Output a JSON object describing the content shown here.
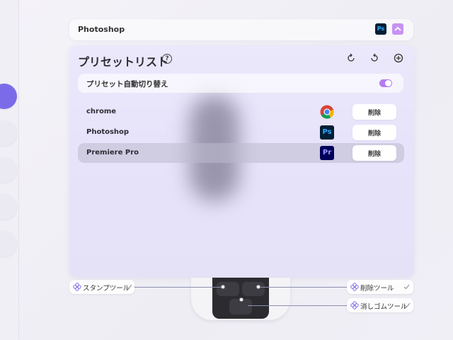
{
  "app_bar": {
    "title": "Photoshop",
    "ps_label": "Ps"
  },
  "panel": {
    "title": "プリセットリスト",
    "help": "?",
    "auto_switch": {
      "label": "プリセット自動切り替え",
      "enabled": true
    },
    "presets": [
      {
        "name": "chrome",
        "icon": "chrome-icon",
        "delete_label": "削除"
      },
      {
        "name": "Photoshop",
        "icon": "photoshop-icon",
        "icon_text": "Ps",
        "delete_label": "削除"
      },
      {
        "name": "Premiere Pro",
        "icon": "premiere-pro-icon",
        "icon_text": "Pr",
        "delete_label": "削除",
        "selected": true
      }
    ]
  },
  "assignments": {
    "left": "スタンプツール",
    "right_top": "削除ツール",
    "right_bottom": "消しゴムツール"
  },
  "colors": {
    "accent": "#7b6be8",
    "toggle": "#b57cf0",
    "collapse": "#c792f2"
  }
}
